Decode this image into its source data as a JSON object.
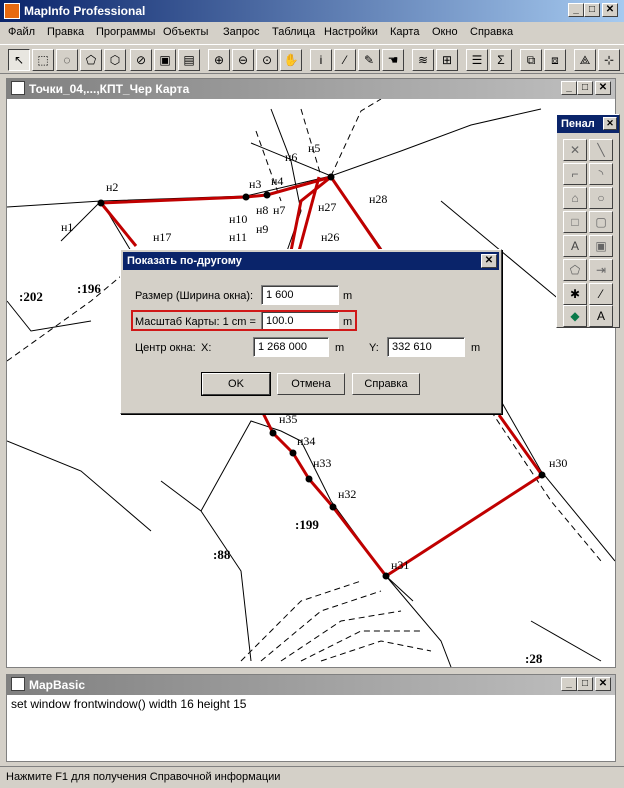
{
  "app": {
    "title": "MapInfo Professional"
  },
  "menu": [
    "Файл",
    "Правка",
    "Программы",
    "Объекты",
    "Запрос",
    "Таблица",
    "Настройки",
    "Карта",
    "Окно",
    "Справка"
  ],
  "map_window": {
    "title": "Точки_04,...,КПТ_Чер Карта",
    "parcels": [
      ":202",
      ":196",
      ":199",
      ":88",
      ":28"
    ],
    "points": [
      "н1",
      "н2",
      "н3",
      "н4",
      "н5",
      "н6",
      "н7",
      "н8",
      "н9",
      "н10",
      "н11",
      "н17",
      "н26",
      "н27",
      "н28",
      "н30",
      "н31",
      "н32",
      "н33",
      "н34",
      "н35"
    ]
  },
  "penal": {
    "title": "Пенал"
  },
  "dialog": {
    "title": "Показать по-другому",
    "size_label": "Размер (Ширина окна):",
    "size_value": "1 600",
    "size_unit": "m",
    "scale_label": "Масштаб Карты: 1 cm =",
    "scale_value": "100.0",
    "scale_unit": "m",
    "center_label": "Центр окна:",
    "x_label": "X:",
    "x_value": "1 268 000",
    "x_unit": "m",
    "y_label": "Y:",
    "y_value": "332 610",
    "y_unit": "m",
    "ok": "OK",
    "cancel": "Отмена",
    "help": "Справка"
  },
  "mapbasic": {
    "title": "MapBasic",
    "command": "set window frontwindow() width 16 height 15"
  },
  "status": "Нажмите F1 для получения Справочной информации",
  "colors": {
    "title_active": "#0a246a",
    "highlight_line": "#c00000",
    "red_box": "#d01818"
  }
}
